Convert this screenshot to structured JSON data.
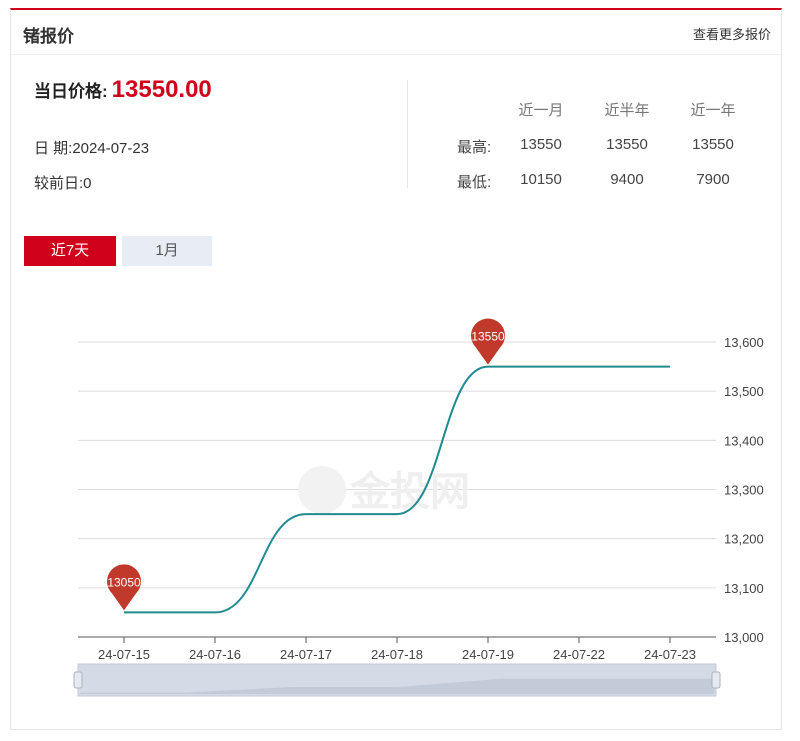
{
  "header": {
    "title": "锗报价",
    "more_link": "查看更多报价"
  },
  "summary": {
    "price_label": "当日价格:",
    "price_value": "13550.00",
    "date_label": "日 期:",
    "date_value": "2024-07-23",
    "change_label": "较前日:",
    "change_value": "0"
  },
  "stats": {
    "headers": [
      "近一月",
      "近半年",
      "近一年"
    ],
    "rows": [
      {
        "label": "最高:",
        "values": [
          "13550",
          "13550",
          "13550"
        ]
      },
      {
        "label": "最低:",
        "values": [
          "10150",
          "9400",
          "7900"
        ]
      }
    ]
  },
  "range_buttons": {
    "active": "近7天",
    "other": "1月"
  },
  "watermark": "金投网",
  "colors": {
    "accent": "#d0021b",
    "line": "#1f8a8f",
    "marker": "#c0392b"
  },
  "chart_data": {
    "type": "line",
    "categories": [
      "24-07-15",
      "24-07-16",
      "24-07-17",
      "24-07-18",
      "24-07-19",
      "24-07-22",
      "24-07-23"
    ],
    "values": [
      13050,
      13050,
      13250,
      13250,
      13550,
      13550,
      13550
    ],
    "y_ticks": [
      "13,000",
      "13,100",
      "13,200",
      "13,300",
      "13,400",
      "13,500",
      "13,600"
    ],
    "ylim": [
      13000,
      13600
    ],
    "y_axis_position": "right",
    "grid": true,
    "markers": [
      {
        "label": "13050",
        "index": 0
      },
      {
        "label": "13550",
        "index": 4
      }
    ],
    "title": "",
    "xlabel": "",
    "ylabel": ""
  }
}
